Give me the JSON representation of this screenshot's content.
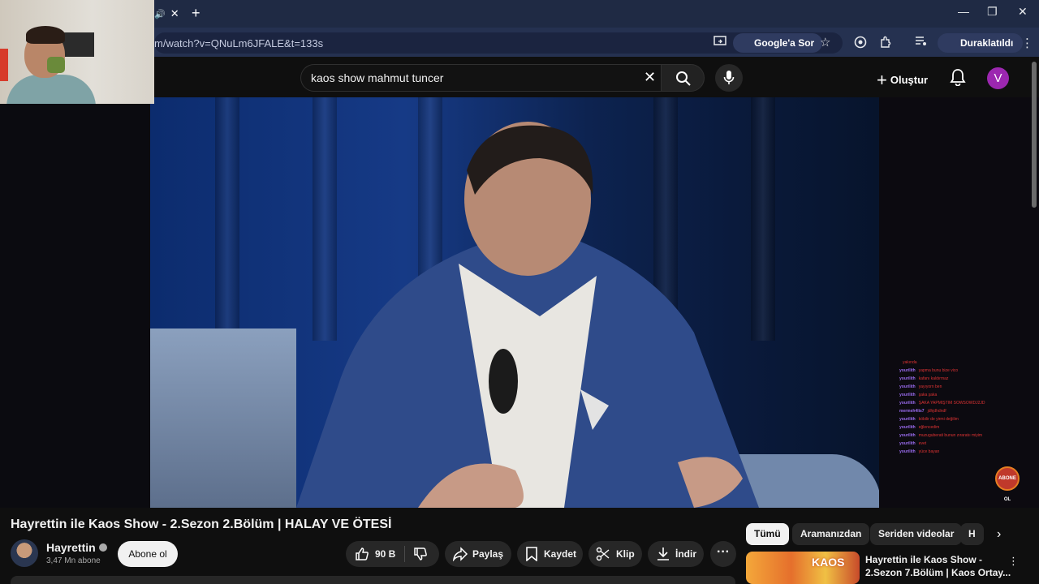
{
  "browser": {
    "url": "m/watch?v=QNuLm6JFALE&t=133s",
    "google_sor_label": "Google'a Sor",
    "profile_label": "Duraklatıldı",
    "new_tab": "+",
    "tab_close": "✕"
  },
  "youtube": {
    "search_value": "kaos show mahmut tuncer",
    "create_label": "Oluştur",
    "avatar_letter": "V"
  },
  "video": {
    "title": "Hayrettin ile Kaos Show - 2.Sezon 2.Bölüm | HALAY VE ÖTESİ",
    "channel_name": "Hayrettin",
    "subscribers": "3,47 Mn abone",
    "subscribe_label": "Abone ol",
    "likes": "90 B",
    "share_label": "Paylaş",
    "save_label": "Kaydet",
    "clip_label": "Klip",
    "download_label": "İndir",
    "overlay_badge": "ABONE OL",
    "chat": [
      {
        "user": "",
        "msg": "yakında"
      },
      {
        "user": "yourilith",
        "msg": "yapma bunu bize vico"
      },
      {
        "user": "yourilith",
        "msg": "kafanı kaldırmaz"
      },
      {
        "user": "yourilith",
        "msg": "yayıyorn ben"
      },
      {
        "user": "yourilith",
        "msg": "şaka şaka"
      },
      {
        "user": "yourilith",
        "msg": "ŞAKA YAPMIŞTIM SOWSOWDJ2JD"
      },
      {
        "user": "mermeh4lis7",
        "msg": "jdhjdhdndf"
      },
      {
        "user": "yourilith",
        "msg": "köbilir de yirmi değilim"
      },
      {
        "user": "yourilith",
        "msg": "eğlencedim"
      },
      {
        "user": "yourilith",
        "msg": "muzuguberati bunun zıraratıı miyim"
      },
      {
        "user": "yourilith",
        "msg": "evet"
      },
      {
        "user": "yourilith",
        "msg": "yüce bayan"
      }
    ]
  },
  "recommendations": {
    "chips": [
      "Tümü",
      "Aramanızdan",
      "Seriden videolar",
      "H"
    ],
    "items": [
      {
        "title": "Hayrettin ile Kaos Show - 2.Sezon 7.Bölüm | Kaos Ortay...",
        "thumb_word": "KAOS"
      }
    ]
  },
  "colors": {
    "tabstrip": "#1f2a44",
    "addressbar": "#253150",
    "youtube_bg": "#0f0f0f",
    "avatar": "#9c27b0"
  }
}
